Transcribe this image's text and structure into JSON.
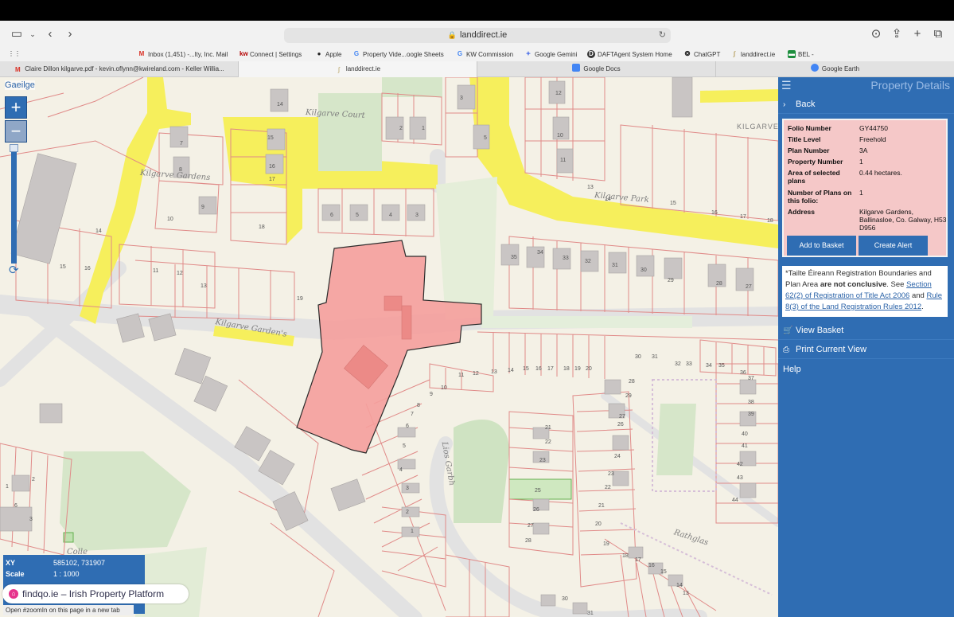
{
  "browser": {
    "url": "landdirect.ie",
    "bookmarks": [
      {
        "label": "Inbox (1,451) -...lty, Inc. Mail",
        "icon": "gmail-icon",
        "color": "#d93025"
      },
      {
        "label": "Connect | Settings",
        "icon": "kw-icon",
        "color": "#b40101"
      },
      {
        "label": "Apple",
        "icon": "apple-icon",
        "color": "#222222"
      },
      {
        "label": "Property Vide...oogle Sheets",
        "icon": "google-icon",
        "color": "#4285f4"
      },
      {
        "label": "KW Commission",
        "icon": "google-icon",
        "color": "#4285f4"
      },
      {
        "label": "Google Gemini",
        "icon": "gemini-icon",
        "color": "#5b7be8"
      },
      {
        "label": "DAFTAgent System Home",
        "icon": "daft-icon",
        "color": "#333333"
      },
      {
        "label": "ChatGPT",
        "icon": "chatgpt-icon",
        "color": "#222222"
      },
      {
        "label": "landdirect.ie",
        "icon": "landdirect-icon",
        "color": "#b6a060"
      },
      {
        "label": "BEL -",
        "icon": "bel-icon",
        "color": "#1e8e3e"
      }
    ],
    "tabs": [
      {
        "label": "Claire Dillon kilgarve.pdf - kevin.oflynn@kwireland.com - Keller Willia...",
        "icon": "gmail-icon",
        "active": false
      },
      {
        "label": "landdirect.ie",
        "icon": "landdirect-icon",
        "active": true
      },
      {
        "label": "Google Docs",
        "icon": "docs-icon",
        "active": false
      },
      {
        "label": "Google Earth",
        "icon": "earth-icon",
        "active": false
      }
    ]
  },
  "map": {
    "language_link": "Gaeilge",
    "zoom_in": "+",
    "zoom_out": "−",
    "streets": {
      "kilgarve_court": "Kilgarve Court",
      "kilgarve_gardens": "Kilgarve Gardens",
      "kilgarve_gardens_2": "Kilgarve Garden's",
      "kilgarve_park": "Kilgarve Park",
      "kilgarve": "KILGARVE",
      "lios_garbh": "Lios Garbh",
      "rathglas": "Rathglas",
      "colle": "Colle"
    },
    "coords": {
      "xy_label": "XY",
      "xy_value": "585102, 731907",
      "scale_label": "Scale",
      "scale_value": "1 : 1000"
    },
    "findqo": "findqo.ie – Irish Property Platform",
    "zoomin_note": "Open #zoomIn on this page in a new tab"
  },
  "panel": {
    "title": "Property Details",
    "back": "Back",
    "details": [
      {
        "key": "Folio Number",
        "value": "GY44750"
      },
      {
        "key": "Title Level",
        "value": "Freehold"
      },
      {
        "key": "Plan Number",
        "value": "3A"
      },
      {
        "key": "Property Number",
        "value": "1"
      },
      {
        "key": "Area of selected plans",
        "value": "0.44 hectares."
      },
      {
        "key": "Number of Plans on this folio:",
        "value": "1"
      },
      {
        "key": "Address",
        "value": "Kilgarve Gardens, Ballinasloe, Co. Galway, H53 D956"
      }
    ],
    "add_basket": "Add to Basket",
    "create_alert": "Create Alert",
    "disclaimer": {
      "pre": "*Tailte Éireann Registration Boundaries and Plan Area ",
      "bold": "are not conclusive",
      "mid": ". See ",
      "link1": "Section 62(2) of Registration of Title Act 2006",
      "and": " and ",
      "link2": "Rule 8(3) of the Land Registration Rules 2012",
      "end": "."
    },
    "view_basket": "View Basket",
    "print_view": "Print Current View",
    "help": "Help"
  }
}
